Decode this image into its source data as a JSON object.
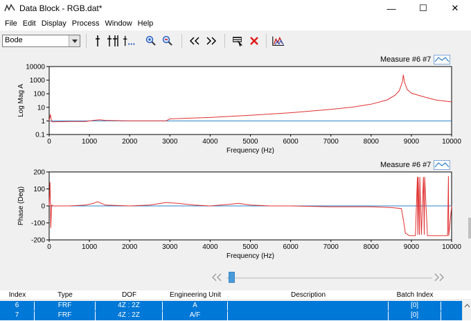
{
  "window": {
    "title": "Data Block - RGB.dat*"
  },
  "menu": [
    "File",
    "Edit",
    "Display",
    "Process",
    "Window",
    "Help"
  ],
  "toolbar": {
    "view_select": "Bode"
  },
  "plot_top": {
    "legend": "Measure #6 #7",
    "ylabel": "Log Mag  A",
    "xlabel": "Frequency (Hz)",
    "yticks": [
      "10000",
      "1000",
      "100",
      "10",
      "1",
      "0.1"
    ],
    "xticks": [
      "0",
      "1000",
      "2000",
      "3000",
      "4000",
      "5000",
      "6000",
      "7000",
      "8000",
      "9000",
      "10000"
    ]
  },
  "plot_bottom": {
    "legend": "Measure #6 #7",
    "ylabel": "Phase (Deg)",
    "xlabel": "Frequency (Hz)",
    "yticks": [
      "200",
      "100",
      "0",
      "-100",
      "-200"
    ],
    "xticks": [
      "0",
      "1000",
      "2000",
      "3000",
      "4000",
      "5000",
      "6000",
      "7000",
      "8000",
      "9000",
      "10000"
    ]
  },
  "chart_data": [
    {
      "type": "line",
      "ylabel": "Log Mag  A",
      "xlabel": "Frequency (Hz)",
      "yscale": "log",
      "xlim": [
        0,
        10000
      ],
      "ylim": [
        0.1,
        10000
      ],
      "series": [
        {
          "name": "Measure #6",
          "color": "#e03030",
          "x": [
            0,
            30,
            60,
            100,
            500,
            900,
            1100,
            1250,
            1400,
            2000,
            2900,
            3000,
            4000,
            5000,
            6000,
            7000,
            7500,
            8000,
            8400,
            8600,
            8700,
            8780,
            8800,
            8830,
            8900,
            9000,
            9300,
            9600,
            10000
          ],
          "y": [
            1,
            3,
            0.9,
            0.85,
            0.9,
            0.9,
            1.1,
            1.2,
            1.1,
            1.0,
            1.0,
            1.4,
            1.8,
            2.6,
            4,
            7,
            10,
            17,
            35,
            80,
            170,
            800,
            2500,
            700,
            200,
            110,
            60,
            35,
            25
          ]
        },
        {
          "name": "Measure #7",
          "color": "#2c7fc8",
          "x": [
            0,
            10000
          ],
          "y": [
            1,
            1
          ]
        }
      ]
    },
    {
      "type": "line",
      "ylabel": "Phase (Deg)",
      "xlabel": "Frequency (Hz)",
      "xlim": [
        0,
        10000
      ],
      "ylim": [
        -200,
        200
      ],
      "series": [
        {
          "name": "Measure #6",
          "color": "#e03030",
          "x": [
            0,
            20,
            40,
            60,
            100,
            500,
            900,
            1100,
            1200,
            1400,
            2000,
            2500,
            2900,
            3200,
            3600,
            4000,
            4500,
            4700,
            5000,
            5500,
            6000,
            7000,
            7500,
            8000,
            8500,
            8750,
            8800,
            8850,
            8950,
            9100,
            9150,
            9160,
            9170,
            9200,
            9210,
            9250,
            9300,
            9320,
            9330,
            9400,
            9900,
            9920,
            9930,
            10000
          ],
          "y": [
            0,
            140,
            -130,
            5,
            0,
            0,
            5,
            15,
            25,
            5,
            0,
            5,
            20,
            15,
            5,
            0,
            10,
            15,
            5,
            0,
            0,
            -5,
            -5,
            -5,
            -10,
            -15,
            -80,
            -160,
            -175,
            -175,
            170,
            -170,
            170,
            -170,
            170,
            -170,
            170,
            -170,
            170,
            -175,
            -175,
            175,
            -175,
            0
          ]
        },
        {
          "name": "Measure #7",
          "color": "#2c7fc8",
          "x": [
            0,
            10000
          ],
          "y": [
            0,
            0
          ]
        }
      ]
    }
  ],
  "table": {
    "headers": [
      "Index",
      "Type",
      "DOF",
      "Engineering Unit",
      "Description",
      "Batch Index"
    ],
    "rows": [
      [
        "6",
        "FRF",
        "4Z : 2Z",
        "A",
        "",
        "[0]"
      ],
      [
        "7",
        "FRF",
        "4Z : 2Z",
        "A/F",
        "",
        "[0]"
      ]
    ]
  }
}
